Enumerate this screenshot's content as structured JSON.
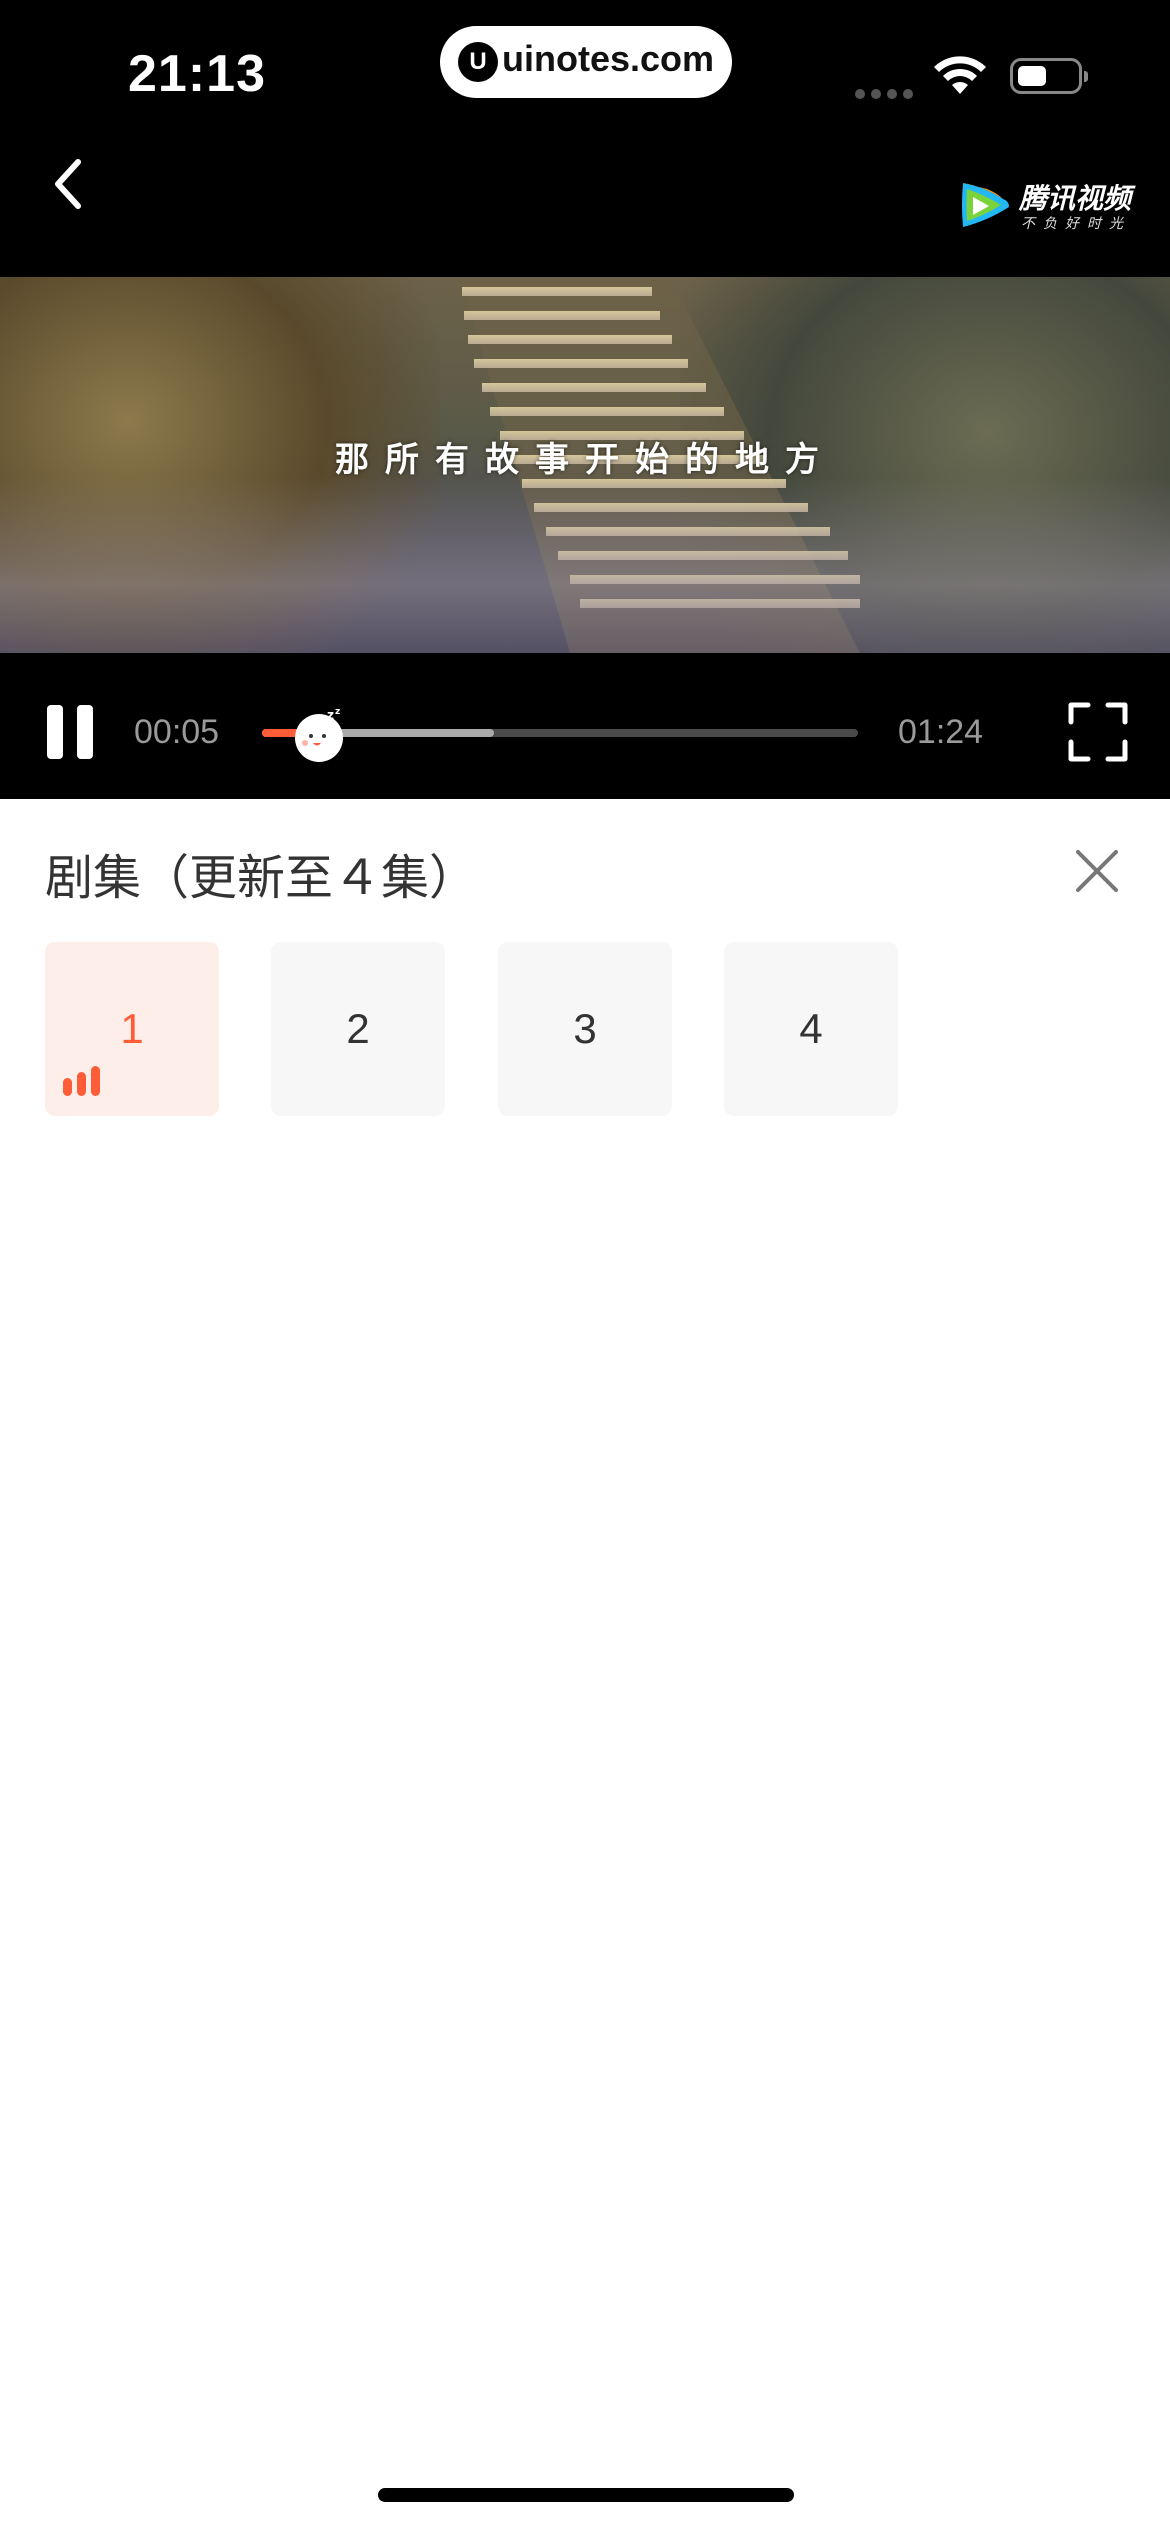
{
  "status_bar": {
    "time": "21:13",
    "url": "uinotes.com",
    "url_logo": "U"
  },
  "header": {
    "brand": "腾讯视频",
    "slogan": "不负好时光"
  },
  "video": {
    "subtitle": "那所有故事开始的地方"
  },
  "player": {
    "current_time": "00:05",
    "total_time": "01:24",
    "played_fraction": 0.065,
    "buffered_fraction": 0.39,
    "accent_color": "#ff5c38"
  },
  "episodes_panel": {
    "title": "剧集（更新至４集）",
    "items": [
      {
        "label": "1",
        "active": true
      },
      {
        "label": "2",
        "active": false
      },
      {
        "label": "3",
        "active": false
      },
      {
        "label": "4",
        "active": false
      }
    ]
  },
  "icons": [
    "back-icon",
    "pause-icon",
    "fullscreen-icon",
    "close-icon",
    "wifi-icon",
    "battery-icon",
    "playing-bars-icon",
    "tencent-video-logo"
  ]
}
